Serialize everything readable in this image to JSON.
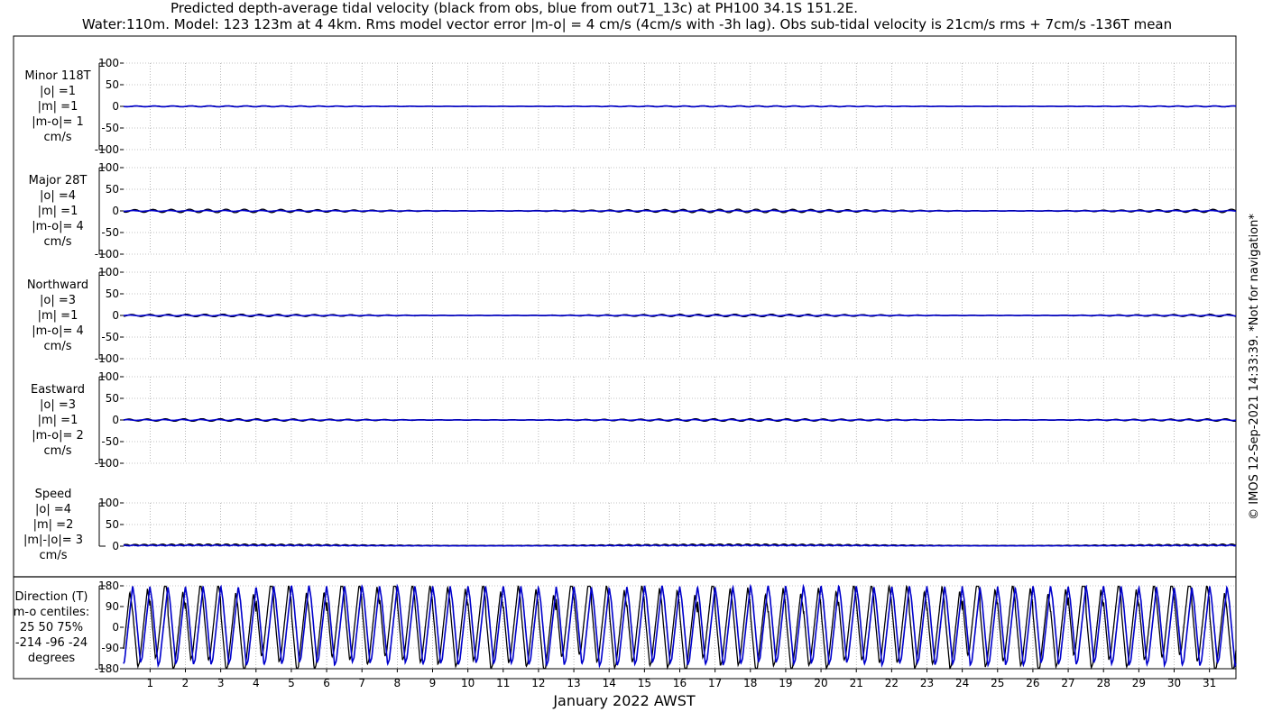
{
  "title_line1": "Predicted depth-average tidal velocity (black from obs, blue from out71_13c) at PH100 34.1S 151.2E.",
  "title_line2": "Water:110m. Model: 123 123m at 4 4km. Rms model vector error |m-o| = 4 cm/s (4cm/s with -3h lag). Obs sub-tidal velocity is 21cm/s rms + 7cm/s -136T mean",
  "credit": "© IMOS 12-Sep-2021 14:33:39. *Not for navigation*",
  "colors": {
    "obs": "#000000",
    "model": "#0000cc",
    "grid": "#888888"
  },
  "chart_data": [
    {
      "type": "line",
      "name": "Minor 118T",
      "label_lines": [
        "Minor 118T",
        "|o| =1",
        "|m| =1",
        "|m-o|= 1",
        "cm/s"
      ],
      "ylim": [
        -100,
        100
      ],
      "yticks": [
        100,
        50,
        0,
        -50,
        -100
      ],
      "xlim": [
        0.25,
        31.75
      ],
      "x": "day of January 2022",
      "obs_amplitude": 1,
      "model_amplitude": 1
    },
    {
      "type": "line",
      "name": "Major 28T",
      "label_lines": [
        "Major 28T",
        "|o| =4",
        "|m| =1",
        "|m-o|= 4",
        "cm/s"
      ],
      "ylim": [
        -100,
        100
      ],
      "yticks": [
        100,
        50,
        0,
        -50,
        -100
      ],
      "xlim": [
        0.25,
        31.75
      ],
      "obs_amplitude": 4,
      "model_amplitude": 1
    },
    {
      "type": "line",
      "name": "Northward",
      "label_lines": [
        "Northward",
        "|o| =3",
        "|m| =1",
        "|m-o|= 4",
        "cm/s"
      ],
      "ylim": [
        -100,
        100
      ],
      "yticks": [
        100,
        50,
        0,
        -50,
        -100
      ],
      "xlim": [
        0.25,
        31.75
      ],
      "obs_amplitude": 3,
      "model_amplitude": 1
    },
    {
      "type": "line",
      "name": "Eastward",
      "label_lines": [
        "Eastward",
        "|o| =3",
        "|m| =1",
        "|m-o|= 2",
        "cm/s"
      ],
      "ylim": [
        -100,
        100
      ],
      "yticks": [
        100,
        50,
        0,
        -50,
        -100
      ],
      "xlim": [
        0.25,
        31.75
      ],
      "obs_amplitude": 3,
      "model_amplitude": 1
    },
    {
      "type": "line",
      "name": "Speed",
      "label_lines": [
        "Speed",
        "|o| =4",
        "|m| =2",
        "|m|-|o|= 3",
        "cm/s"
      ],
      "ylim": [
        0,
        100
      ],
      "yticks": [
        100,
        50,
        0
      ],
      "xlim": [
        0.25,
        31.75
      ],
      "obs_amplitude": 4,
      "model_amplitude": 2
    },
    {
      "type": "line",
      "name": "Direction (T)",
      "label_lines": [
        "Direction (T)",
        "m-o centiles:",
        "25  50  75%",
        "-214  -96  -24",
        "degrees"
      ],
      "ylim": [
        -180,
        180
      ],
      "yticks": [
        180,
        90,
        0,
        -90,
        -180
      ],
      "xlim": [
        0.25,
        31.75
      ],
      "cycles_per_day": 1.0
    }
  ],
  "xaxis": {
    "ticks": [
      "1",
      "2",
      "3",
      "4",
      "5",
      "6",
      "7",
      "8",
      "9",
      "10",
      "11",
      "12",
      "13",
      "14",
      "15",
      "16",
      "17",
      "18",
      "19",
      "20",
      "21",
      "22",
      "23",
      "24",
      "25",
      "26",
      "27",
      "28",
      "29",
      "30",
      "31"
    ],
    "title": "January 2022 AWST"
  }
}
